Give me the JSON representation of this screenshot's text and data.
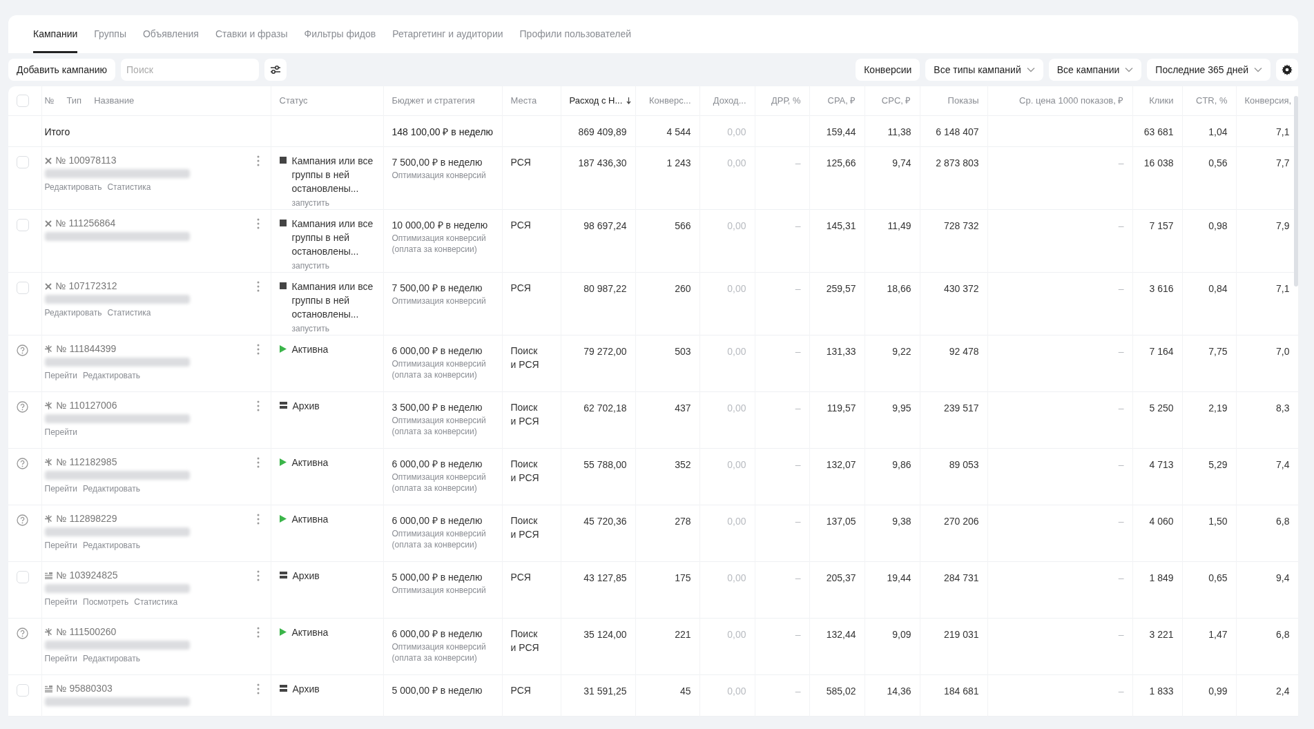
{
  "tabs": [
    {
      "label": "Кампании",
      "selected": true
    },
    {
      "label": "Группы",
      "selected": false
    },
    {
      "label": "Объявления",
      "selected": false
    },
    {
      "label": "Ставки и фразы",
      "selected": false
    },
    {
      "label": "Фильтры фидов",
      "selected": false
    },
    {
      "label": "Ретаргетинг и аудитории",
      "selected": false
    },
    {
      "label": "Профили пользователей",
      "selected": false
    }
  ],
  "toolbar": {
    "add_button": "Добавить кампанию",
    "search": {
      "placeholder": "Поиск"
    },
    "right_buttons": [
      {
        "label": "Конверсии",
        "dropdown": false
      },
      {
        "label": "Все типы кампаний",
        "dropdown": true
      },
      {
        "label": "Все кампании",
        "dropdown": true
      },
      {
        "label": "Последние 365 дней",
        "dropdown": true
      }
    ]
  },
  "table": {
    "name_headers": [
      "№",
      "Тип",
      "Название"
    ],
    "columns": [
      {
        "label": "Статус",
        "sorted": false
      },
      {
        "label": "Бюджет и стратегия",
        "sorted": false
      },
      {
        "label": "Места",
        "sorted": false
      },
      {
        "label": "Расход с Н...",
        "sorted": true
      },
      {
        "label": "Конверс...",
        "sorted": false
      },
      {
        "label": "Доход...",
        "sorted": false
      },
      {
        "label": "ДРР, %",
        "sorted": false
      },
      {
        "label": "CPA, ₽",
        "sorted": false
      },
      {
        "label": "CPC, ₽",
        "sorted": false
      },
      {
        "label": "Показы",
        "sorted": false
      },
      {
        "label": "Ср. цена 1000 показов, ₽",
        "sorted": false
      },
      {
        "label": "Клики",
        "sorted": false
      },
      {
        "label": "CTR, %",
        "sorted": false
      },
      {
        "label": "Конверсия,",
        "sorted": false
      }
    ],
    "select_all": {
      "checked": false
    },
    "total": {
      "label": "Итого",
      "budget": "148 100,00 ₽ в неделю",
      "metrics": {
        "spend": "869 409,89",
        "conversions": "4 544",
        "income": "0,00",
        "cpa": "159,44",
        "cpc": "11,38",
        "impressions": "6 148 407",
        "clicks": "63 681",
        "ctr": "1,04",
        "conversion_rate": "7,1"
      }
    },
    "rows": [
      {
        "marker": {
          "kind": "checkbox",
          "checked": false
        },
        "type_icon": {
          "kind": "cross"
        },
        "number": "№ 100978113",
        "actions": [
          "Редактировать",
          "Статистика"
        ],
        "status": {
          "kind": "stopped",
          "text": "Кампания или все группы в ней остановлены...",
          "action": "запустить"
        },
        "budget": "7 500,00 ₽ в неделю",
        "strategy": [
          "Оптимизация конверсий"
        ],
        "places": "РСЯ",
        "metrics": [
          "187 436,30",
          "1 243",
          "0,00",
          "–",
          "125,66",
          "9,74",
          "2 873 803",
          "–",
          "16 038",
          "0,56",
          "7,7"
        ]
      },
      {
        "marker": {
          "kind": "checkbox",
          "checked": false
        },
        "type_icon": {
          "kind": "cross"
        },
        "number": "№ 111256864",
        "actions": [],
        "status": {
          "kind": "stopped",
          "text": "Кампания или все группы в ней остановлены...",
          "action": "запустить"
        },
        "budget": "10 000,00 ₽ в неделю",
        "strategy": [
          "Оптимизация конверсий",
          "(оплата за конверсии)"
        ],
        "places": "РСЯ",
        "metrics": [
          "98 697,24",
          "566",
          "0,00",
          "–",
          "145,31",
          "11,49",
          "728 732",
          "–",
          "7 157",
          "0,98",
          "7,9"
        ]
      },
      {
        "marker": {
          "kind": "checkbox",
          "checked": false
        },
        "type_icon": {
          "kind": "cross"
        },
        "number": "№ 107172312",
        "actions": [
          "Редактировать",
          "Статистика"
        ],
        "status": {
          "kind": "stopped",
          "text": "Кампания или все группы в ней остановлены...",
          "action": "запустить"
        },
        "budget": "7 500,00 ₽ в неделю",
        "strategy": [
          "Оптимизация конверсий"
        ],
        "places": "РСЯ",
        "metrics": [
          "80 987,22",
          "260",
          "0,00",
          "–",
          "259,57",
          "18,66",
          "430 372",
          "–",
          "3 616",
          "0,84",
          "7,1"
        ]
      },
      {
        "marker": {
          "kind": "help"
        },
        "type_icon": {
          "kind": "spark"
        },
        "number": "№ 111844399",
        "actions": [
          "Перейти",
          "Редактировать"
        ],
        "status": {
          "kind": "active",
          "text": "Активна"
        },
        "budget": "6 000,00 ₽ в неделю",
        "strategy": [
          "Оптимизация конверсий",
          "(оплата за конверсии)"
        ],
        "places": "Поиск и РСЯ",
        "metrics": [
          "79 272,00",
          "503",
          "0,00",
          "–",
          "131,33",
          "9,22",
          "92 478",
          "–",
          "7 164",
          "7,75",
          "7,0"
        ]
      },
      {
        "marker": {
          "kind": "help"
        },
        "type_icon": {
          "kind": "spark"
        },
        "number": "№ 110127006",
        "actions": [
          "Перейти"
        ],
        "status": {
          "kind": "archive",
          "text": "Архив"
        },
        "budget": "3 500,00 ₽ в неделю",
        "strategy": [
          "Оптимизация конверсий",
          "(оплата за конверсии)"
        ],
        "places": "Поиск и РСЯ",
        "metrics": [
          "62 702,18",
          "437",
          "0,00",
          "–",
          "119,57",
          "9,95",
          "239 517",
          "–",
          "5 250",
          "2,19",
          "8,3"
        ]
      },
      {
        "marker": {
          "kind": "help"
        },
        "type_icon": {
          "kind": "spark"
        },
        "number": "№ 112182985",
        "actions": [
          "Перейти",
          "Редактировать"
        ],
        "status": {
          "kind": "active",
          "text": "Активна"
        },
        "budget": "6 000,00 ₽ в неделю",
        "strategy": [
          "Оптимизация конверсий",
          "(оплата за конверсии)"
        ],
        "places": "Поиск и РСЯ",
        "metrics": [
          "55 788,00",
          "352",
          "0,00",
          "–",
          "132,07",
          "9,86",
          "89 053",
          "–",
          "4 713",
          "5,29",
          "7,4"
        ]
      },
      {
        "marker": {
          "kind": "help"
        },
        "type_icon": {
          "kind": "spark"
        },
        "number": "№ 112898229",
        "actions": [
          "Перейти",
          "Редактировать"
        ],
        "status": {
          "kind": "active",
          "text": "Активна"
        },
        "budget": "6 000,00 ₽ в неделю",
        "strategy": [
          "Оптимизация конверсий",
          "(оплата за конверсии)"
        ],
        "places": "Поиск и РСЯ",
        "metrics": [
          "45 720,36",
          "278",
          "0,00",
          "–",
          "137,05",
          "9,38",
          "270 206",
          "–",
          "4 060",
          "1,50",
          "6,8"
        ]
      },
      {
        "marker": {
          "kind": "checkbox",
          "checked": false
        },
        "type_icon": {
          "kind": "lines"
        },
        "number": "№ 103924825",
        "actions": [
          "Перейти",
          "Посмотреть",
          "Статистика"
        ],
        "status": {
          "kind": "archive",
          "text": "Архив"
        },
        "budget": "5 000,00 ₽ в неделю",
        "strategy": [
          "Оптимизация конверсий"
        ],
        "places": "РСЯ",
        "metrics": [
          "43 127,85",
          "175",
          "0,00",
          "–",
          "205,37",
          "19,44",
          "284 731",
          "–",
          "1 849",
          "0,65",
          "9,4"
        ]
      },
      {
        "marker": {
          "kind": "help"
        },
        "type_icon": {
          "kind": "spark"
        },
        "number": "№ 111500260",
        "actions": [
          "Перейти",
          "Редактировать"
        ],
        "status": {
          "kind": "active",
          "text": "Активна"
        },
        "budget": "6 000,00 ₽ в неделю",
        "strategy": [
          "Оптимизация конверсий",
          "(оплата за конверсии)"
        ],
        "places": "Поиск и РСЯ",
        "metrics": [
          "35 124,00",
          "221",
          "0,00",
          "–",
          "132,44",
          "9,09",
          "219 031",
          "–",
          "3 221",
          "1,47",
          "6,8"
        ]
      },
      {
        "marker": {
          "kind": "checkbox",
          "checked": false
        },
        "type_icon": {
          "kind": "lines"
        },
        "number": "№ 95880303",
        "actions": [],
        "status": {
          "kind": "archive",
          "text": "Архив"
        },
        "budget": "5 000,00 ₽ в неделю",
        "places": "РСЯ",
        "metrics": [
          "31 591,25",
          "45",
          "0,00",
          "–",
          "585,02",
          "14,36",
          "184 681",
          "–",
          "1 833",
          "0,99",
          "2,4"
        ]
      }
    ]
  }
}
